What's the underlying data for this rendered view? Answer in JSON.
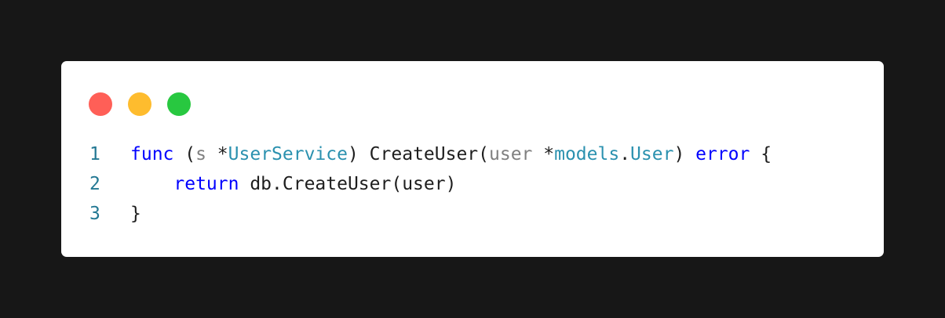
{
  "window": {
    "controls": [
      {
        "name": "close",
        "color": "#ff5f57"
      },
      {
        "name": "minimize",
        "color": "#febc2e"
      },
      {
        "name": "maximize",
        "color": "#28c840"
      }
    ]
  },
  "code": {
    "language": "go",
    "lines": [
      {
        "number": "1",
        "tokens": [
          {
            "t": "func",
            "c": "kw"
          },
          {
            "t": " (",
            "c": "pu"
          },
          {
            "t": "s",
            "c": "pm"
          },
          {
            "t": " *",
            "c": "pu"
          },
          {
            "t": "UserService",
            "c": "ty"
          },
          {
            "t": ") CreateUser(",
            "c": "pu"
          },
          {
            "t": "user",
            "c": "pm"
          },
          {
            "t": " *",
            "c": "pu"
          },
          {
            "t": "models",
            "c": "ty"
          },
          {
            "t": ".",
            "c": "pu"
          },
          {
            "t": "User",
            "c": "ty"
          },
          {
            "t": ") ",
            "c": "pu"
          },
          {
            "t": "error",
            "c": "kw"
          },
          {
            "t": " {",
            "c": "pu"
          }
        ]
      },
      {
        "number": "2",
        "tokens": [
          {
            "t": "    ",
            "c": "pu"
          },
          {
            "t": "return",
            "c": "kw"
          },
          {
            "t": " db.CreateUser(user)",
            "c": "pu"
          }
        ]
      },
      {
        "number": "3",
        "tokens": [
          {
            "t": "}",
            "c": "pu"
          }
        ]
      }
    ]
  }
}
